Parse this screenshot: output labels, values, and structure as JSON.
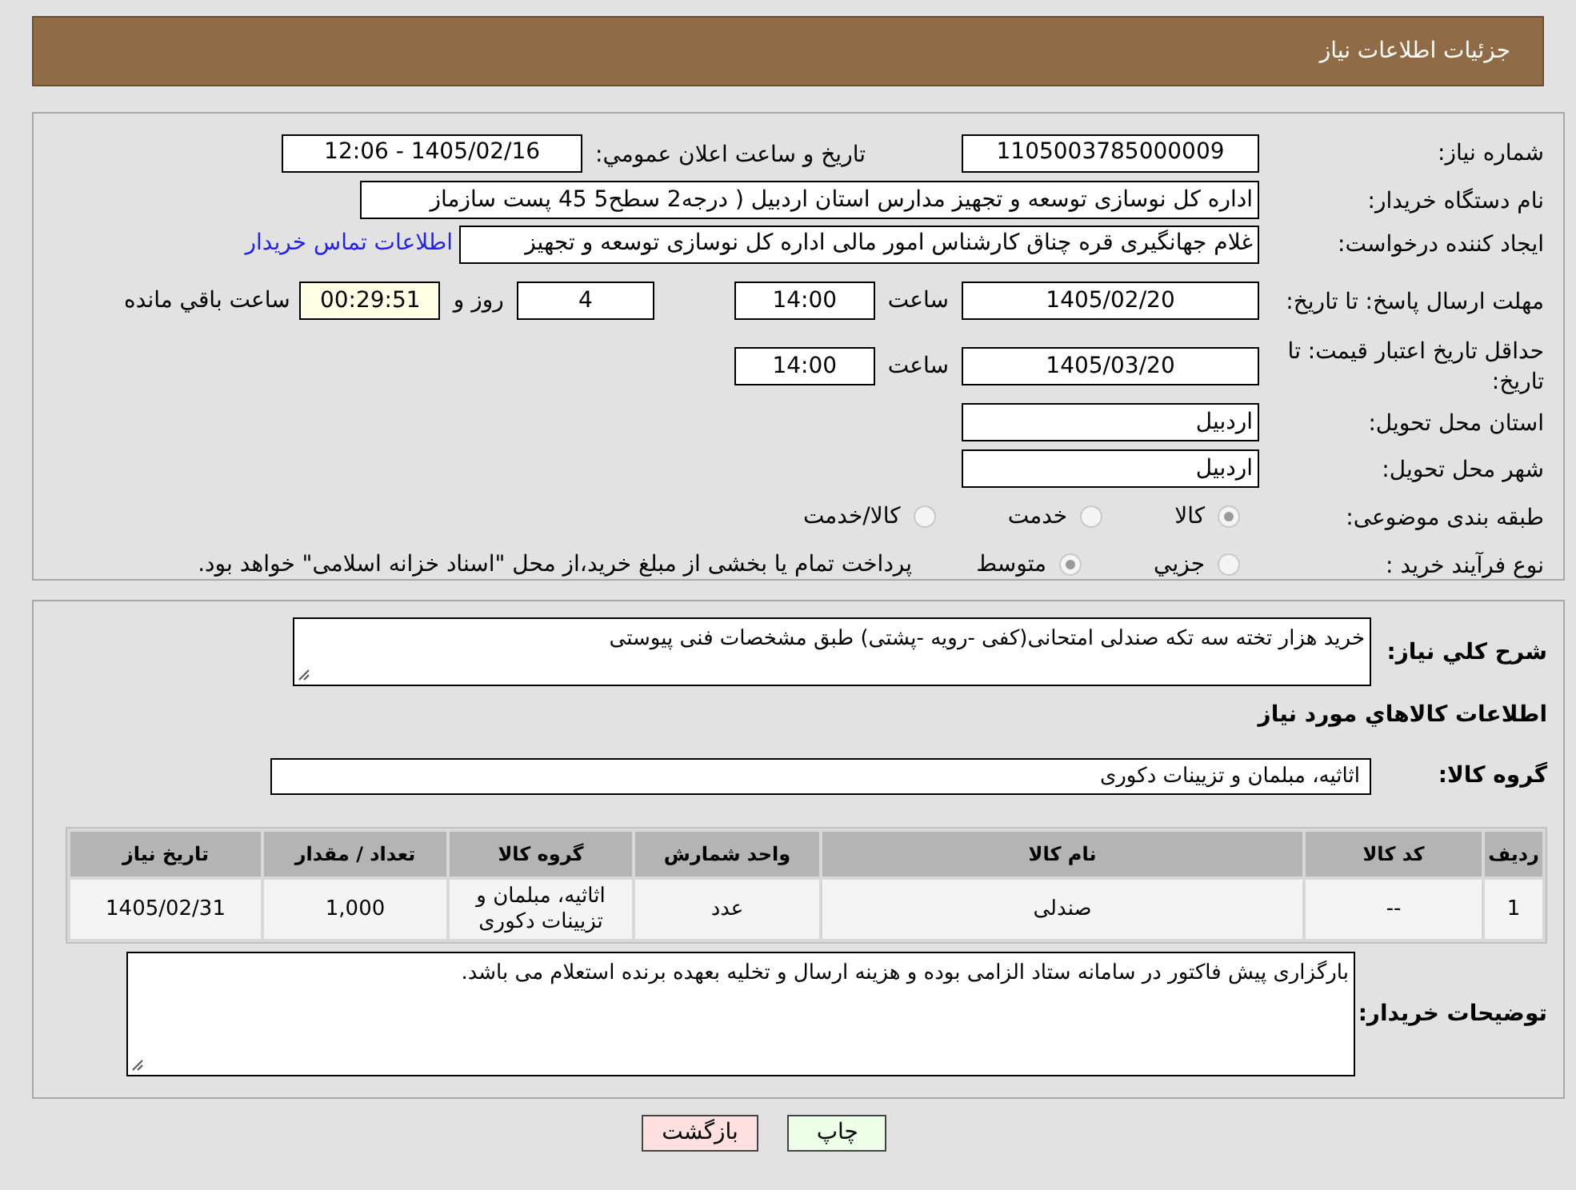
{
  "header": {
    "title": "جزئیات اطلاعات نیاز"
  },
  "need_number": {
    "label": "شماره نیاز:",
    "value": "1105003785000009"
  },
  "announce": {
    "label": "تاريخ و ساعت اعلان عمومي:",
    "value": "1405/02/16 - 12:06"
  },
  "buyer": {
    "label": "نام دستگاه خریدار:",
    "value": "اداره کل نوسازی   توسعه و تجهیز مدارس استان اردبیل ( درجه2  سطح5  45 پست سازماز"
  },
  "creator": {
    "label": "ایجاد کننده درخواست:",
    "value": "غلام جهانگیری قره چناق کارشناس امور مالی اداره کل نوسازی   توسعه و تجهیز",
    "link": "اطلاعات تماس خریدار"
  },
  "deadline": {
    "label": "مهلت ارسال پاسخ: تا تاریخ:",
    "date": "1405/02/20",
    "time_label": "ساعت",
    "time": "14:00",
    "days": "4",
    "days_label": "روز و",
    "remaining": "00:29:51",
    "remaining_label": "ساعت باقي مانده"
  },
  "validity": {
    "label": "حداقل تاریخ اعتبار قیمت: تا تاریخ:",
    "date": "1405/03/20",
    "time_label": "ساعت",
    "time": "14:00"
  },
  "province": {
    "label": "استان محل تحویل:",
    "value": "اردبیل"
  },
  "city": {
    "label": "شهر محل تحویل:",
    "value": "اردبیل"
  },
  "category": {
    "label": "طبقه بندی موضوعی:",
    "options": [
      {
        "label": "کالا",
        "selected": true
      },
      {
        "label": "خدمت",
        "selected": false
      },
      {
        "label": "کالا/خدمت",
        "selected": false
      }
    ]
  },
  "process": {
    "label": "نوع فرآیند خرید :",
    "options": [
      {
        "label": "جزيي",
        "selected": false
      },
      {
        "label": "متوسط",
        "selected": true
      }
    ],
    "note": "پرداخت تمام یا بخشی از مبلغ خرید،از محل \"اسناد خزانه اسلامی\" خواهد بود."
  },
  "description": {
    "label": "شرح کلي نياز:",
    "value": "خرید هزار تخته سه تکه صندلی امتحانی(کفی -رویه -پشتی) طبق مشخصات فنی پیوستی"
  },
  "goods_heading": "اطلاعات کالاهاي مورد نياز",
  "goods_group": {
    "label": "گروه کالا:",
    "value": "اثاثیه، مبلمان و تزیینات دکوری"
  },
  "table": {
    "columns": [
      "ردیف",
      "کد کالا",
      "نام کالا",
      "واحد شمارش",
      "گروه کالا",
      "تعداد / مقدار",
      "تاریخ نیاز"
    ],
    "rows": [
      [
        "1",
        "--",
        "صندلی",
        "عدد",
        "اثاثیه، مبلمان و تزیینات دکوری",
        "1,000",
        "1405/02/31"
      ]
    ]
  },
  "buyer_notes": {
    "label": "توضیحات خریدار:",
    "value": "بارگزاری پیش فاکتور در سامانه ستاد الزامی بوده و هزینه ارسال و تخلیه بعهده برنده استعلام می باشد."
  },
  "buttons": [
    {
      "label": "چاپ",
      "kind": "print"
    },
    {
      "label": "بازگشت",
      "kind": "back"
    }
  ]
}
